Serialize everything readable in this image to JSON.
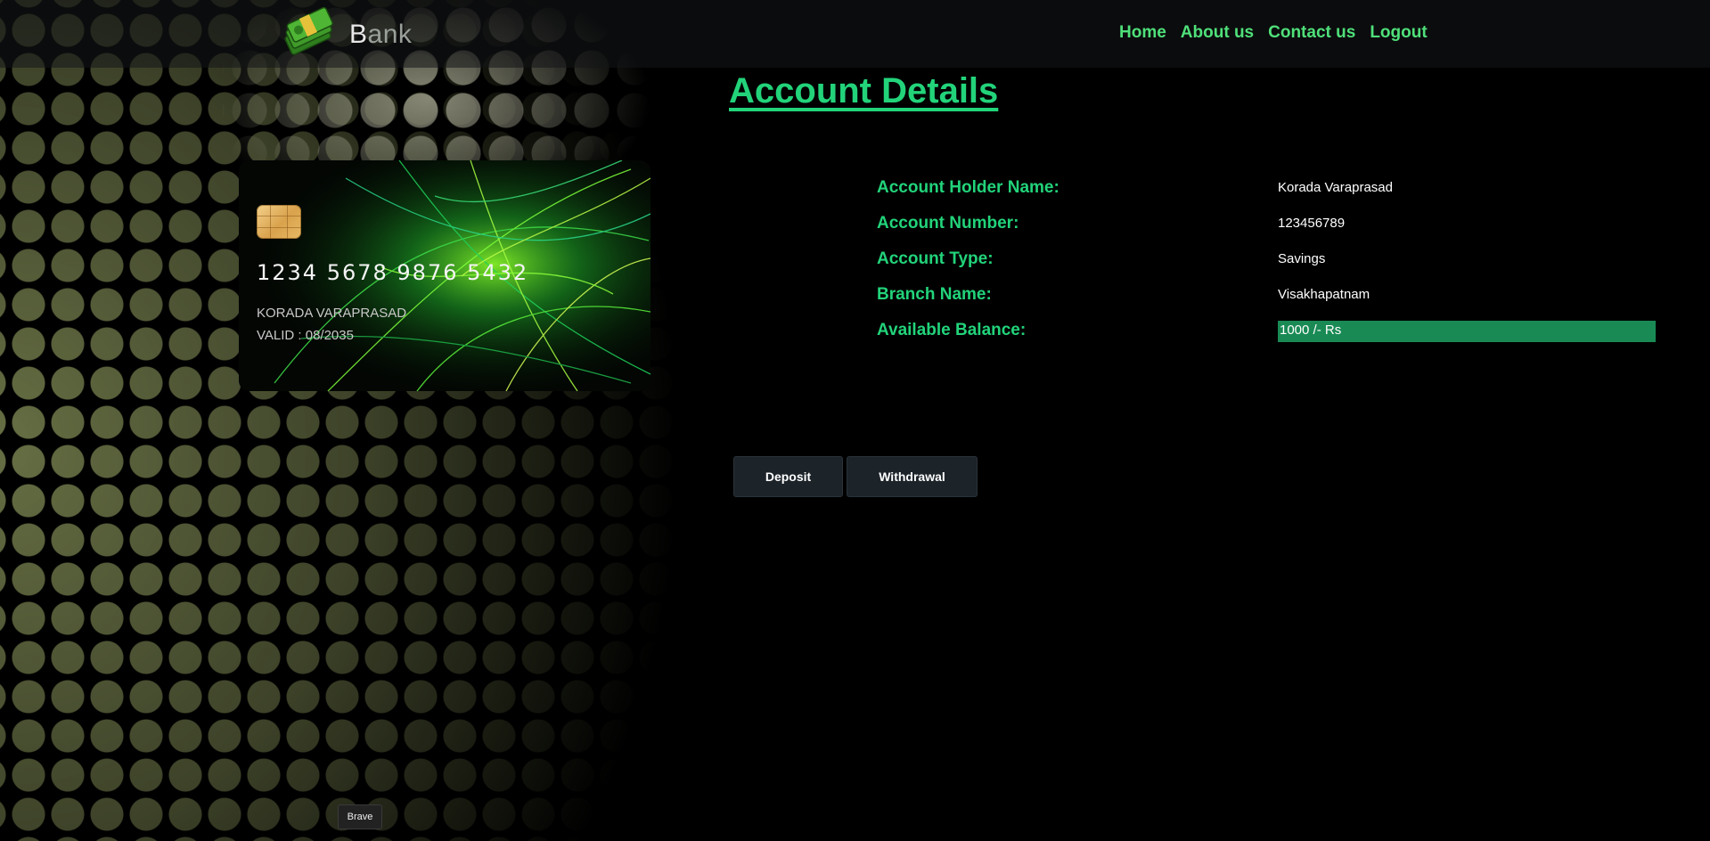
{
  "header": {
    "brand_first": "B",
    "brand_rest": "ank",
    "nav": [
      {
        "label": "Home"
      },
      {
        "label": "About us"
      },
      {
        "label": "Contact us"
      },
      {
        "label": "Logout"
      }
    ]
  },
  "page_title": "Account Details",
  "card": {
    "number": "1234 5678 9876 5432",
    "holder": "KORADA VARAPRASAD",
    "valid": "VALID : 08/2035"
  },
  "details": [
    {
      "label": "Account Holder Name:",
      "value": "Korada Varaprasad"
    },
    {
      "label": "Account Number:",
      "value": "123456789"
    },
    {
      "label": "Account Type:",
      "value": "Savings"
    },
    {
      "label": "Branch Name:",
      "value": "Visakhapatnam"
    },
    {
      "label": "Available Balance:",
      "value": "1000 /- Rs"
    }
  ],
  "actions": {
    "deposit_label": "Deposit",
    "withdrawal_label": "Withdrawal"
  },
  "footer_tag": "Brave",
  "colors": {
    "accent": "#22d37a",
    "nav": "#4fe07a",
    "balance_highlight": "#1a8a55",
    "button_bg": "#1c2329"
  },
  "icons": {
    "logo": "money-stack-icon",
    "card_chip": "chip-icon"
  }
}
